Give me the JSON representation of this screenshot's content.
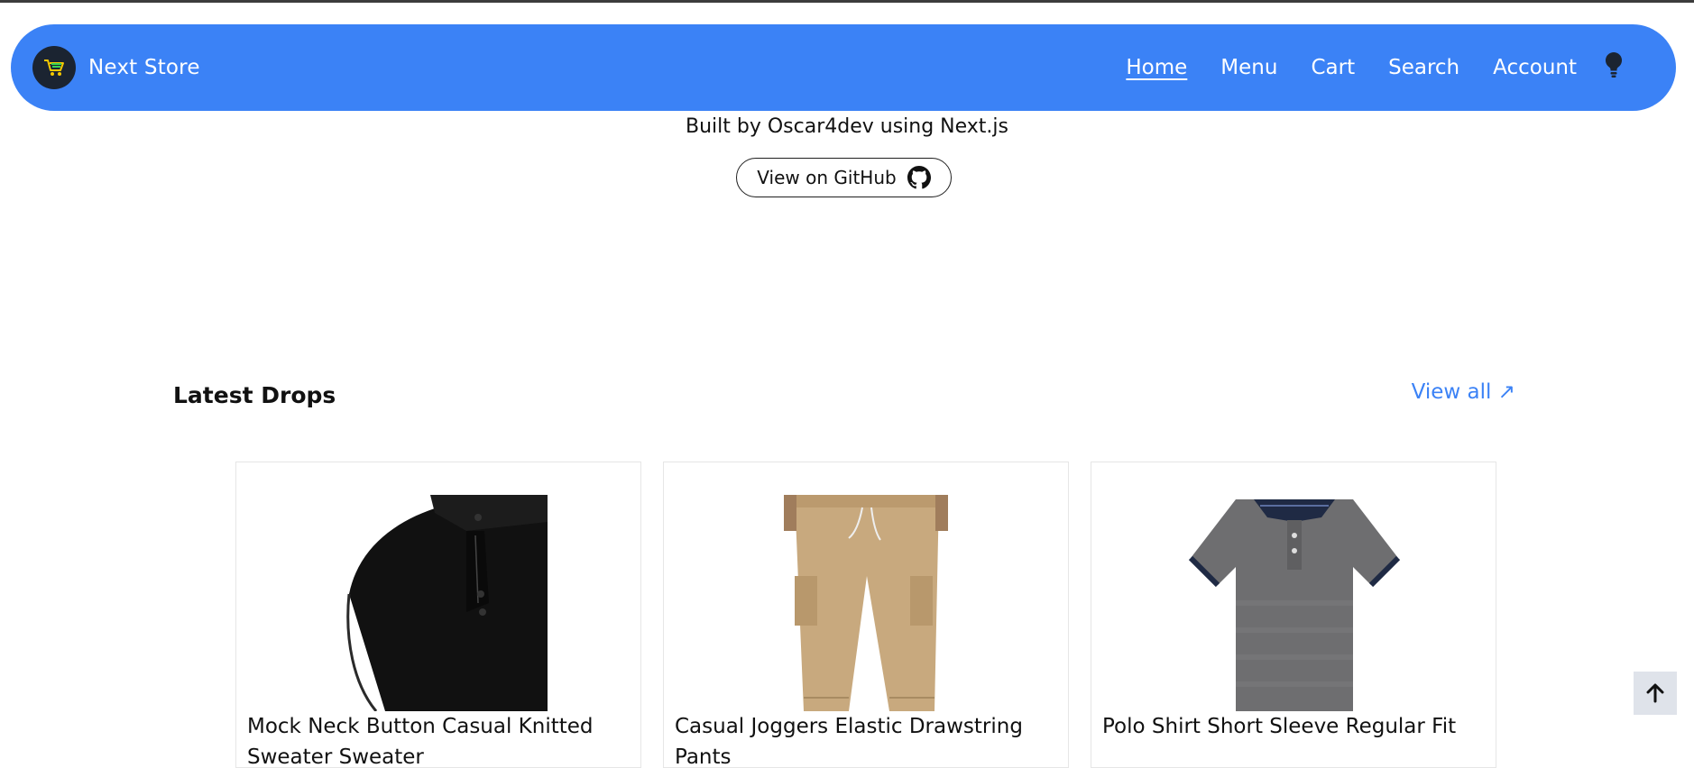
{
  "header": {
    "brand_name": "Next Store",
    "nav": [
      {
        "label": "Home",
        "active": true
      },
      {
        "label": "Menu"
      },
      {
        "label": "Cart"
      },
      {
        "label": "Search"
      },
      {
        "label": "Account"
      }
    ]
  },
  "hero": {
    "credit": "Built by Oscar4dev using Next.js",
    "github_button": "View on GitHub"
  },
  "latest": {
    "title": "Latest Drops",
    "view_all": "View all ↗",
    "products": [
      {
        "title": "Mock Neck Button Casual Knitted Sweater Sweater"
      },
      {
        "title": "Casual Joggers Elastic Drawstring Pants"
      },
      {
        "title": "Polo Shirt Short Sleeve Regular Fit"
      }
    ]
  },
  "colors": {
    "accent": "#3b82f6",
    "nav_text": "#ffffff",
    "logo_bg": "#1b2431"
  },
  "icons": [
    "cart-icon",
    "lightbulb-icon",
    "github-icon",
    "arrow-up-icon"
  ]
}
